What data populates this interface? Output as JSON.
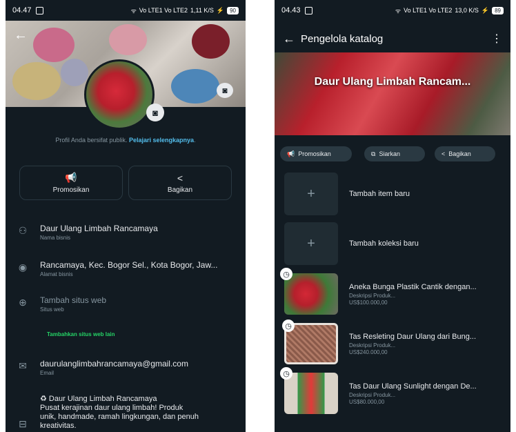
{
  "left": {
    "status": {
      "time": "04.47",
      "signal": "Vo LTE1 Vo LTE2",
      "speed": "1,11 K/S",
      "battery": "90"
    },
    "public_note": {
      "text": "Profil Anda bersifat publik.",
      "link": "Pelajari selengkapnya"
    },
    "actions": [
      {
        "label": "Promosikan"
      },
      {
        "label": "Bagikan"
      }
    ],
    "business_name": {
      "value": "Daur Ulang Limbah Rancamaya",
      "label": "Nama bisnis"
    },
    "address": {
      "value": "Rancamaya, Kec. Bogor Sel., Kota Bogor, Jaw...",
      "label": "Alamat bisnis"
    },
    "website": {
      "value": "Tambah situs web",
      "label": "Situs web",
      "add_more": "Tambahkan situs web lain"
    },
    "email": {
      "value": "daurulanglimbahrancamaya@gmail.com",
      "label": "Email"
    },
    "description": {
      "line1": "♻ Daur Ulang Limbah Rancamaya",
      "line2": "Pusat kerajinan daur ulang limbah! Produk",
      "line3": "unik, handmade, ramah lingkungan, dan penuh",
      "line4": "kreativitas."
    }
  },
  "right": {
    "status": {
      "time": "04.43",
      "signal": "Vo LTE1 Vo LTE2",
      "speed": "13,0 K/S",
      "battery": "89"
    },
    "title": "Pengelola katalog",
    "banner_title": "Daur Ulang Limbah Rancam...",
    "pills": [
      {
        "label": "Promosikan"
      },
      {
        "label": "Siarkan"
      },
      {
        "label": "Bagikan"
      }
    ],
    "add_item": "Tambah item baru",
    "add_collection": "Tambah koleksi baru",
    "items": [
      {
        "name": "Aneka Bunga Plastik Cantik dengan...",
        "desc": "Deskripsi Produk...",
        "price": "US$100.000,00"
      },
      {
        "name": "Tas Resleting Daur Ulang dari Bung...",
        "desc": "Deskripsi Produk...",
        "price": "US$240.000,00"
      },
      {
        "name": "Tas Daur Ulang Sunlight dengan De...",
        "desc": "Deskripsi Produk...",
        "price": "US$80.000,00"
      }
    ]
  },
  "colors": {
    "background": "#121b22",
    "accent_link": "#53bdeb",
    "accent_green": "#25d366",
    "chip": "#2a3942"
  }
}
